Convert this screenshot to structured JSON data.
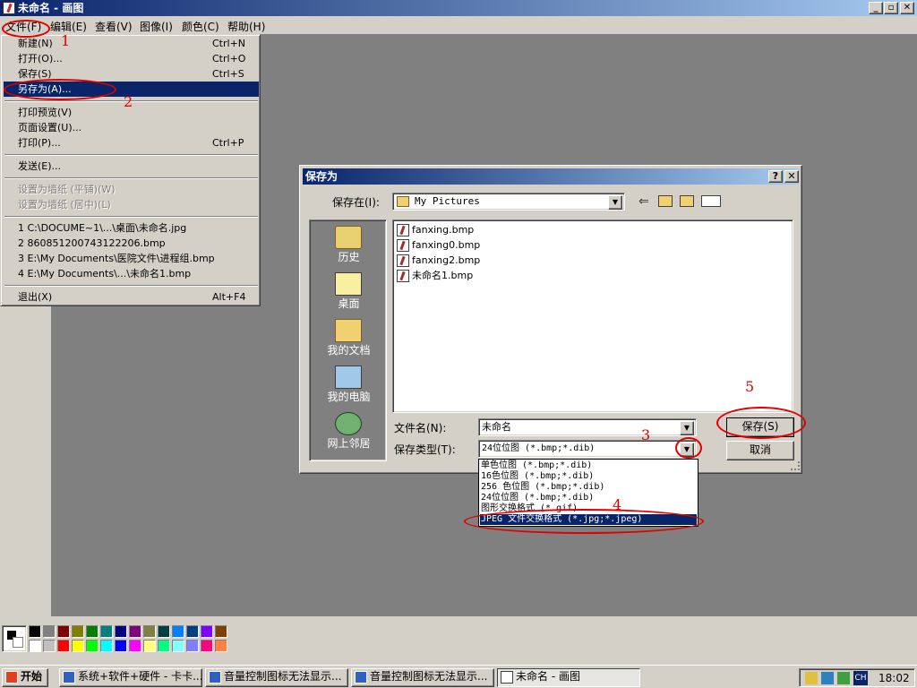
{
  "app": {
    "title": "未命名 - 画图"
  },
  "window_buttons": [
    "_",
    "▫",
    "✕"
  ],
  "menubar": [
    {
      "label": "文件(F)"
    },
    {
      "label": "编辑(E)"
    },
    {
      "label": "查看(V)"
    },
    {
      "label": "图像(I)"
    },
    {
      "label": "颜色(C)"
    },
    {
      "label": "帮助(H)"
    }
  ],
  "file_menu": {
    "items": [
      {
        "label": "新建(N)",
        "shortcut": "Ctrl+N"
      },
      {
        "label": "打开(O)...",
        "shortcut": "Ctrl+O"
      },
      {
        "label": "保存(S)",
        "shortcut": "Ctrl+S"
      },
      {
        "label": "另存为(A)...",
        "shortcut": "",
        "selected": true
      },
      {
        "label": "打印预览(V)",
        "shortcut": ""
      },
      {
        "label": "页面设置(U)...",
        "shortcut": ""
      },
      {
        "label": "打印(P)...",
        "shortcut": "Ctrl+P"
      },
      {
        "label": "发送(E)...",
        "shortcut": ""
      },
      {
        "label": "设置为墙纸 (平铺)(W)",
        "shortcut": "",
        "disabled": true
      },
      {
        "label": "设置为墙纸 (居中)(L)",
        "shortcut": "",
        "disabled": true
      },
      {
        "label": "1 C:\\DOCUME~1\\...\\桌面\\未命名.jpg",
        "shortcut": ""
      },
      {
        "label": "2 860851200743122206.bmp",
        "shortcut": ""
      },
      {
        "label": "3 E:\\My Documents\\医院文件\\进程组.bmp",
        "shortcut": ""
      },
      {
        "label": "4 E:\\My Documents\\...\\未命名1.bmp",
        "shortcut": ""
      },
      {
        "label": "退出(X)",
        "shortcut": "Alt+F4"
      }
    ]
  },
  "dialog": {
    "title": "保存为",
    "help_btn": "?",
    "close_btn": "✕",
    "save_in_label": "保存在(I):",
    "save_in_value": "My Pictures",
    "nav_icons": [
      "back-icon",
      "up-folder-icon",
      "new-folder-icon",
      "view-menu-icon"
    ],
    "places": [
      {
        "label": "历史",
        "icon": "history-icon"
      },
      {
        "label": "桌面",
        "icon": "desktop-icon"
      },
      {
        "label": "我的文档",
        "icon": "my-documents-icon"
      },
      {
        "label": "我的电脑",
        "icon": "my-computer-icon"
      },
      {
        "label": "网上邻居",
        "icon": "network-icon"
      }
    ],
    "files": [
      "fanxing.bmp",
      "fanxing0.bmp",
      "fanxing2.bmp",
      "未命名1.bmp"
    ],
    "filename_label": "文件名(N):",
    "filename_value": "未命名",
    "filetype_label": "保存类型(T):",
    "filetype_value": "24位位图 (*.bmp;*.dib)",
    "save_button": "保存(S)",
    "cancel_button": "取消",
    "filetype_options": [
      "单色位图 (*.bmp;*.dib)",
      "16色位图 (*.bmp;*.dib)",
      "256 色位图 (*.bmp;*.dib)",
      "24位位图 (*.bmp;*.dib)",
      "图形交换格式 (*.gif)",
      "JPEG 文件交换格式 (*.jpg;*.jpeg)"
    ],
    "filetype_selected_index": 5
  },
  "annotations": [
    "1",
    "2",
    "3",
    "4",
    "5"
  ],
  "palette": {
    "colors_top": [
      "#000000",
      "#808080",
      "#800000",
      "#808000",
      "#008000",
      "#008080",
      "#000080",
      "#800080",
      "#808040",
      "#004040",
      "#0080ff",
      "#004080",
      "#8000ff",
      "#804000"
    ],
    "colors_bottom": [
      "#ffffff",
      "#c0c0c0",
      "#ff0000",
      "#ffff00",
      "#00ff00",
      "#00ffff",
      "#0000ff",
      "#ff00ff",
      "#ffff80",
      "#00ff80",
      "#80ffff",
      "#8080ff",
      "#ff0080",
      "#ff8040"
    ],
    "colors_accent": [
      "#d4d0c8",
      "#0a246a",
      "#e00000"
    ]
  },
  "taskbar": {
    "start": "开始",
    "tasks": [
      {
        "label": "系统+软件+硬件 - 卡卡..."
      },
      {
        "label": "音量控制图标无法显示..."
      },
      {
        "label": "音量控制图标无法显示..."
      },
      {
        "label": "未命名 - 画图",
        "active": true
      }
    ],
    "tray_lang": "CH",
    "clock": "18:02"
  }
}
